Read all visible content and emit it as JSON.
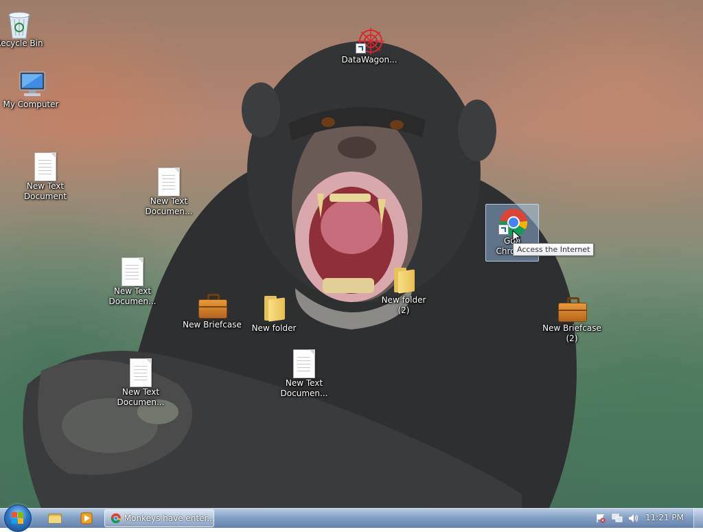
{
  "desktop": {
    "icons": {
      "recycle_bin": "Recycle Bin",
      "my_computer": "My Computer",
      "datawagon": "DataWagon...",
      "text_doc_1": "New Text\nDocument",
      "text_doc_2": "New Text\nDocumen...",
      "text_doc_3": "New Text\nDocumen...",
      "text_doc_4": "New Text\nDocumen...",
      "text_doc_5": "New Text\nDocumen...",
      "briefcase_1": "New Briefcase",
      "briefcase_2": "New Briefcase\n(2)",
      "folder_1": "New folder",
      "folder_2": "New folder\n(2)",
      "chrome": "Goo\nChrome"
    },
    "tooltip": "Access the Internet"
  },
  "taskbar": {
    "active_task_label": "Monkeys have enter...",
    "clock": "11:21 PM"
  },
  "colors": {
    "taskbar": "#7d9bc3",
    "selection": "#a0c8f5",
    "accent": "#2f79c8"
  }
}
